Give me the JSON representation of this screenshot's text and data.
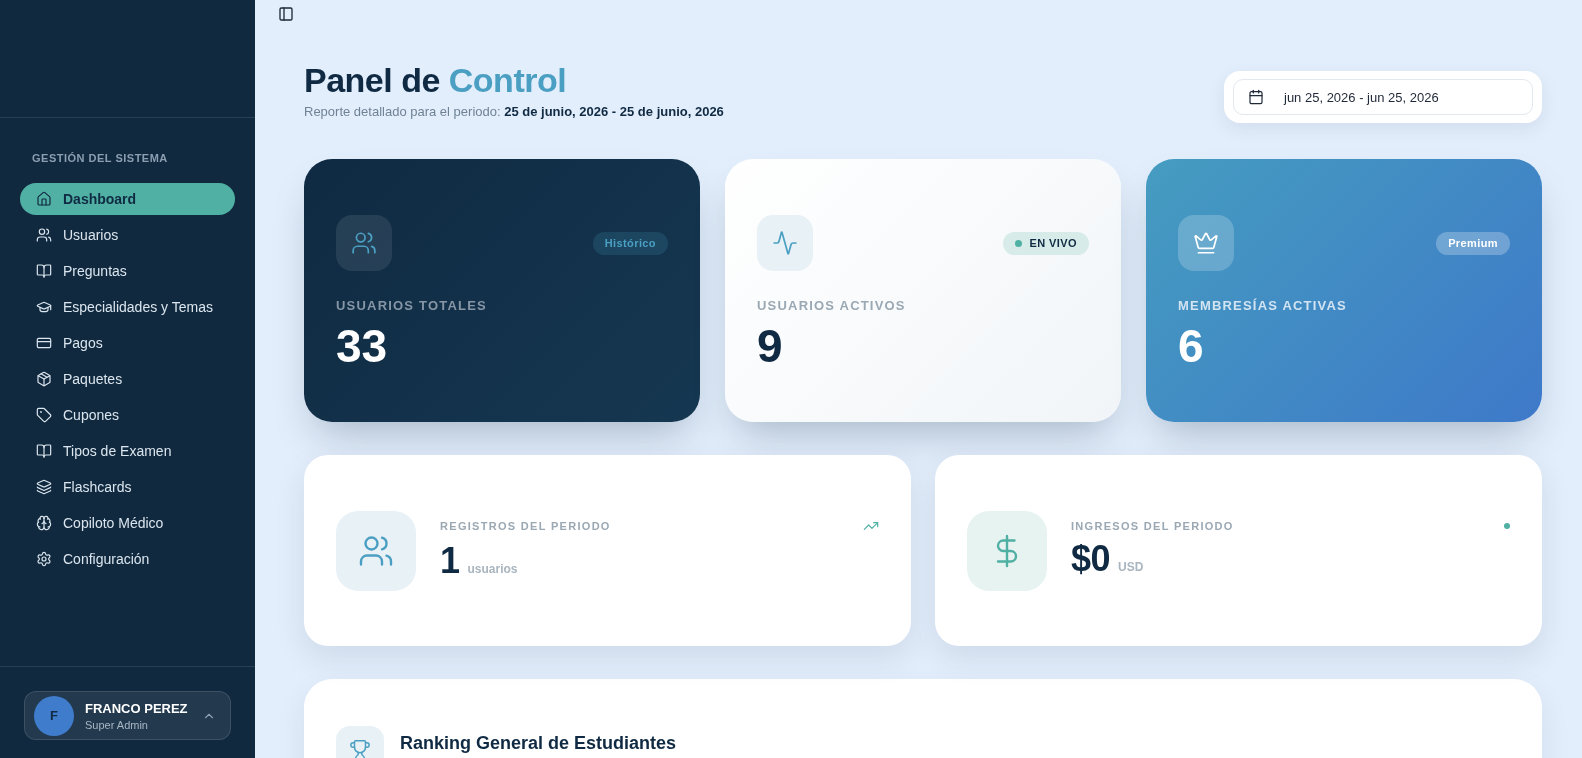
{
  "sidebar": {
    "section_title": "GESTIÓN DEL SISTEMA",
    "items": [
      {
        "label": "Dashboard",
        "selected": true
      },
      {
        "label": "Usuarios",
        "selected": false
      },
      {
        "label": "Preguntas",
        "selected": false
      },
      {
        "label": "Especialidades y Temas",
        "selected": false
      },
      {
        "label": "Pagos",
        "selected": false
      },
      {
        "label": "Paquetes",
        "selected": false
      },
      {
        "label": "Cupones",
        "selected": false
      },
      {
        "label": "Tipos de Examen",
        "selected": false
      },
      {
        "label": "Flashcards",
        "selected": false
      },
      {
        "label": "Copiloto Médico",
        "selected": false
      },
      {
        "label": "Configuración",
        "selected": false
      }
    ],
    "user": {
      "initial": "F",
      "name": "FRANCO PEREZ",
      "role": "Super Admin"
    }
  },
  "header": {
    "title": "Panel de",
    "title_accent": "Control",
    "subtitle": "Reporte detallado para el periodo: **25 de junio, 2026 - 25 de junio, 2026**"
  },
  "date_range": {
    "value": "jun 25, 2026 - jun 25, 2026"
  },
  "stat_cards": [
    {
      "kind": "dark",
      "badge": "Histórico",
      "label": "USUARIOS TOTALES",
      "value": "33"
    },
    {
      "kind": "light",
      "badge": "EN VIVO",
      "label": "USUARIOS ACTIVOS",
      "value": "9"
    },
    {
      "kind": "blue",
      "badge": "Premium",
      "label": "MEMBRESÍAS ACTIVAS",
      "value": "6"
    }
  ],
  "period_cards": [
    {
      "kind": "registrations",
      "label": "REGISTROS DEL PERIODO",
      "value": "1",
      "unit": "usuarios"
    },
    {
      "kind": "revenue",
      "label": "INGRESOS DEL PERIODO",
      "value": "$0",
      "unit": "USD"
    }
  ],
  "ranking": {
    "title": "Ranking General de Estudiantes"
  }
}
